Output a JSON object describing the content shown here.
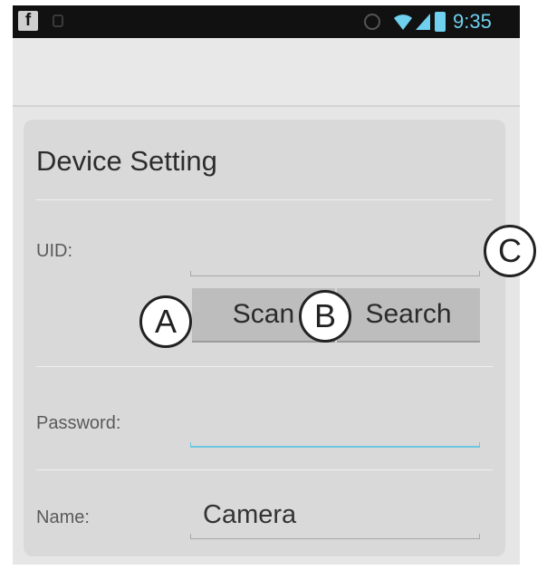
{
  "status_bar": {
    "time": "9:35",
    "icons": [
      "facebook-icon",
      "notification-icon",
      "alarm-icon",
      "wifi-icon",
      "signal-icon",
      "battery-icon"
    ]
  },
  "card": {
    "title": "Device Setting",
    "uid": {
      "label": "UID:",
      "value": ""
    },
    "buttons": {
      "scan": "Scan",
      "search": "Search"
    },
    "password": {
      "label": "Password:",
      "value": ""
    },
    "name": {
      "label": "Name:",
      "value": "Camera"
    }
  },
  "callouts": {
    "a": "A",
    "b": "B",
    "c": "C"
  },
  "colors": {
    "accent_focus": "#6cc6e3",
    "status_time": "#6fd0ef",
    "card_bg": "#d9d9d9",
    "button_bg": "#bdbdbd"
  }
}
